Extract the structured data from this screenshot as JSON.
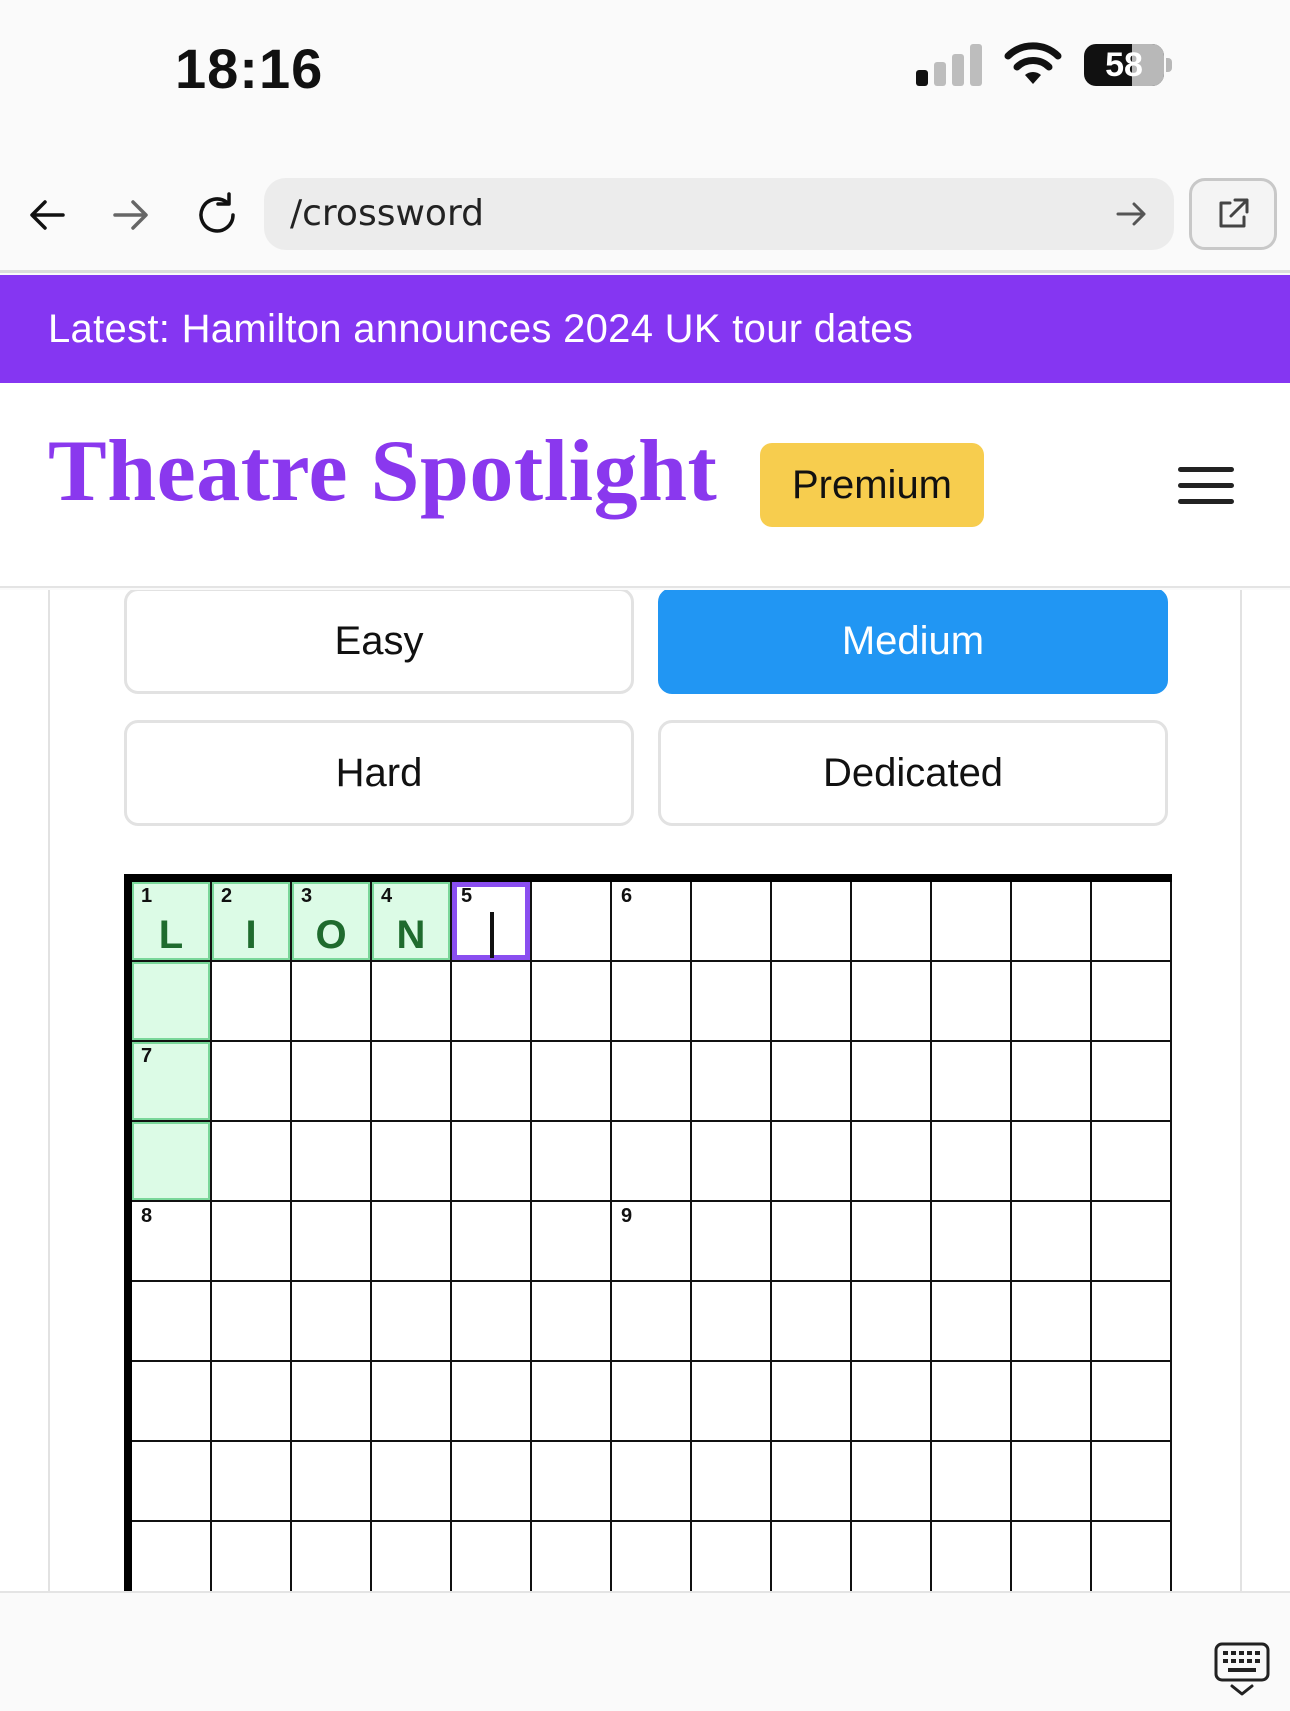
{
  "status_bar": {
    "time": "18:16",
    "battery_percent": "58",
    "signal_bars_active": 1,
    "signal_bars_total": 4
  },
  "browser": {
    "url": "/crossword",
    "icons": [
      "back-arrow-icon",
      "forward-arrow-icon",
      "reload-icon",
      "go-arrow-icon",
      "open-external-icon"
    ]
  },
  "news": {
    "text": "Latest: Hamilton announces 2024 UK tour dates"
  },
  "header": {
    "title": "Theatre Spotlight",
    "badge": "Premium",
    "menu_icon": "hamburger-menu-icon"
  },
  "difficulty": {
    "selected": "Medium",
    "options": [
      "Easy",
      "Medium",
      "Hard",
      "Dedicated"
    ]
  },
  "crossword": {
    "columns": 13,
    "visible_rows": 9,
    "numbers": [
      {
        "row": 0,
        "col": 0,
        "n": "1"
      },
      {
        "row": 0,
        "col": 1,
        "n": "2"
      },
      {
        "row": 0,
        "col": 2,
        "n": "3"
      },
      {
        "row": 0,
        "col": 3,
        "n": "4"
      },
      {
        "row": 0,
        "col": 4,
        "n": "5"
      },
      {
        "row": 0,
        "col": 6,
        "n": "6"
      },
      {
        "row": 2,
        "col": 0,
        "n": "7"
      },
      {
        "row": 4,
        "col": 0,
        "n": "8"
      },
      {
        "row": 4,
        "col": 6,
        "n": "9"
      }
    ],
    "letters": [
      {
        "row": 0,
        "col": 0,
        "ch": "L"
      },
      {
        "row": 0,
        "col": 1,
        "ch": "I"
      },
      {
        "row": 0,
        "col": 2,
        "ch": "O"
      },
      {
        "row": 0,
        "col": 3,
        "ch": "N"
      }
    ],
    "highlighted_cells": [
      {
        "row": 0,
        "col": 0
      },
      {
        "row": 0,
        "col": 1
      },
      {
        "row": 0,
        "col": 2
      },
      {
        "row": 0,
        "col": 3
      },
      {
        "row": 1,
        "col": 0
      },
      {
        "row": 2,
        "col": 0
      },
      {
        "row": 3,
        "col": 0
      }
    ],
    "active_cell": {
      "row": 0,
      "col": 4
    },
    "colors": {
      "highlight": "#dcfbe6",
      "active_border": "#8a4ef0",
      "letter": "#1f6b2e"
    }
  },
  "keyboard": {
    "icon": "keyboard-dismiss-icon"
  },
  "colors": {
    "banner": "#8536f2",
    "title": "#8a38ee",
    "premium": "#f7cd4e",
    "selected_button": "#2196f3"
  }
}
